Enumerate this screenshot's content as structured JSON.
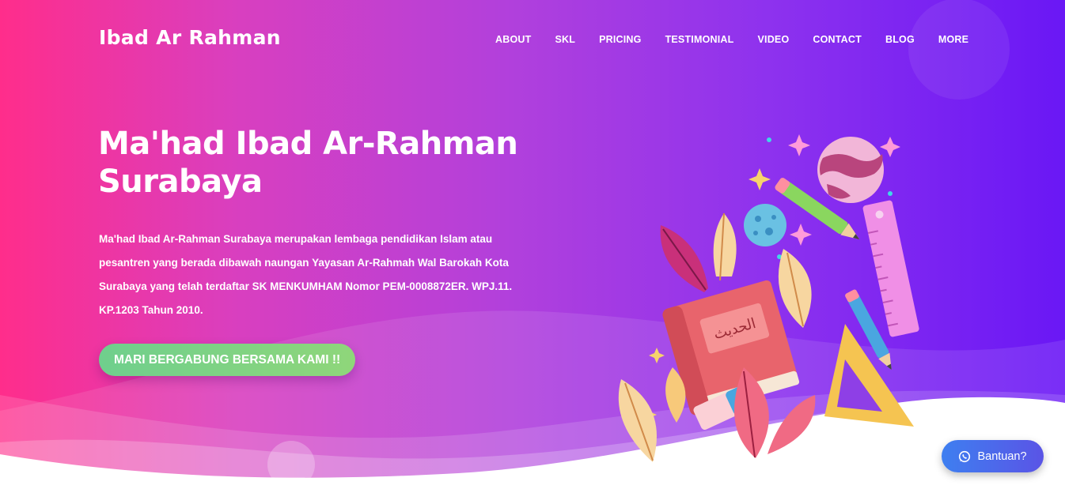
{
  "brand": "Ibad Ar Rahman",
  "nav": {
    "items": [
      "ABOUT",
      "SKL",
      "PRICING",
      "TESTIMONIAL",
      "VIDEO",
      "CONTACT",
      "BLOG",
      "MORE"
    ]
  },
  "hero": {
    "title_line1": "Ma'had Ibad Ar-Rahman",
    "title_line2": "Surabaya",
    "description": "Ma'had Ibad Ar-Rahman Surabaya merupakan lembaga pendidikan Islam atau pesantren yang berada dibawah naungan Yayasan Ar-Rahmah Wal Barokah Kota Surabaya yang telah terdaftar SK MENKUMHAM Nomor PEM-0008872ER. WPJ.11. KP.1203 Tahun 2010.",
    "cta_label": "MARI BERGABUNG BERSAMA KAMI !!"
  },
  "illustration": {
    "book_text": "الحديث"
  },
  "help_button": {
    "label": "Bantuan?",
    "icon": "whatsapp-icon"
  },
  "colors": {
    "gradient_start": "#ff2d8b",
    "gradient_end": "#6a17f5",
    "cta": "#7bd285",
    "help": "#4a6cec"
  }
}
